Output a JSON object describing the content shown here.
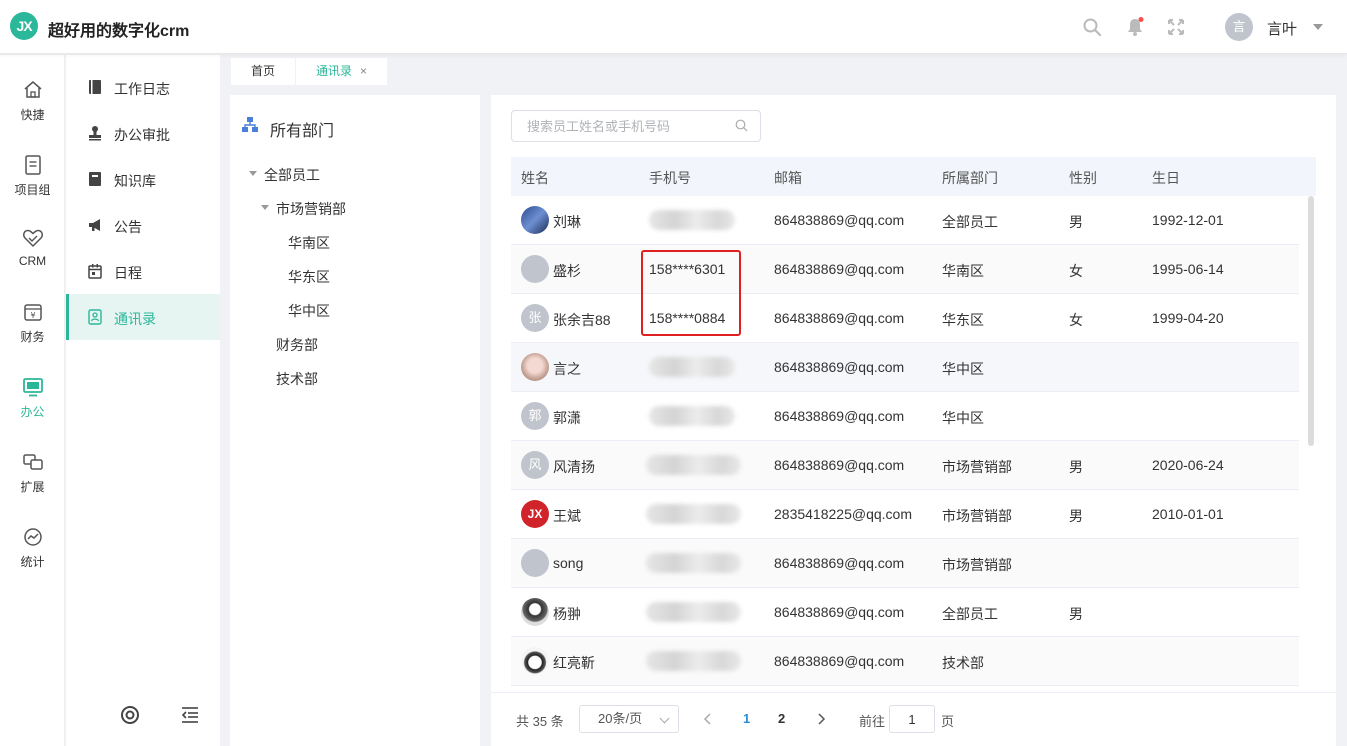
{
  "app": {
    "logo_text": "JX",
    "title": "超好用的数字化crm"
  },
  "header": {
    "user": {
      "avatar_text": "言",
      "name": "言叶"
    },
    "colors": {
      "accent": "#2bb89a",
      "notification_dot": "#ff4d4f"
    }
  },
  "nav_primary": [
    {
      "label": "快捷",
      "icon": "home-icon"
    },
    {
      "label": "项目组",
      "icon": "document-icon"
    },
    {
      "label": "CRM",
      "icon": "handshake-icon"
    },
    {
      "label": "财务",
      "icon": "wallet-icon"
    },
    {
      "label": "办公",
      "icon": "monitor-icon",
      "active": true
    },
    {
      "label": "扩展",
      "icon": "extend-icon"
    },
    {
      "label": "统计",
      "icon": "chart-icon"
    }
  ],
  "nav_secondary": [
    {
      "label": "工作日志",
      "icon": "book-icon"
    },
    {
      "label": "办公审批",
      "icon": "stamp-icon"
    },
    {
      "label": "知识库",
      "icon": "notebook-icon"
    },
    {
      "label": "公告",
      "icon": "megaphone-icon"
    },
    {
      "label": "日程",
      "icon": "calendar-icon"
    },
    {
      "label": "通讯录",
      "icon": "contacts-icon",
      "active": true
    }
  ],
  "tabs": [
    {
      "label": "首页"
    },
    {
      "label": "通讯录",
      "active": true,
      "close": "×"
    }
  ],
  "departments": {
    "title": "所有部门",
    "tree": [
      {
        "label": "全部员工"
      },
      {
        "label": "市场营销部"
      },
      {
        "label": "华南区"
      },
      {
        "label": "华东区"
      },
      {
        "label": "华中区"
      },
      {
        "label": "财务部"
      },
      {
        "label": "技术部"
      }
    ]
  },
  "search": {
    "placeholder": "搜索员工姓名或手机号码",
    "value": ""
  },
  "table": {
    "columns": [
      "姓名",
      "手机号",
      "邮箱",
      "所属部门",
      "性别",
      "生日"
    ],
    "rows": [
      {
        "name": "刘琳",
        "avatar": "",
        "phone": "",
        "email": "864838869@qq.com",
        "dept": "全部员工",
        "gender": "男",
        "birthday": "1992-12-01"
      },
      {
        "name": "盛杉",
        "avatar": "",
        "phone": "158****6301",
        "email": "864838869@qq.com",
        "dept": "华南区",
        "gender": "女",
        "birthday": "1995-06-14"
      },
      {
        "name": "张余吉88",
        "avatar": "张",
        "phone": "158****0884",
        "email": "864838869@qq.com",
        "dept": "华东区",
        "gender": "女",
        "birthday": "1999-04-20"
      },
      {
        "name": "言之",
        "avatar": "",
        "phone": "",
        "email": "864838869@qq.com",
        "dept": "华中区",
        "gender": "",
        "birthday": ""
      },
      {
        "name": "郭潇",
        "avatar": "郭",
        "phone": "",
        "email": "864838869@qq.com",
        "dept": "华中区",
        "gender": "",
        "birthday": ""
      },
      {
        "name": "风清扬",
        "avatar": "风",
        "phone": "",
        "email": "864838869@qq.com",
        "dept": "市场营销部",
        "gender": "男",
        "birthday": "2020-06-24"
      },
      {
        "name": "王斌",
        "avatar": "JX",
        "phone": "",
        "email": "2835418225@qq.com",
        "dept": "市场营销部",
        "gender": "男",
        "birthday": "2010-01-01"
      },
      {
        "name": "song",
        "avatar": "",
        "phone": "",
        "email": "864838869@qq.com",
        "dept": "市场营销部",
        "gender": "",
        "birthday": ""
      },
      {
        "name": "杨翀",
        "avatar": "",
        "phone": "",
        "email": "864838869@qq.com",
        "dept": "全部员工",
        "gender": "男",
        "birthday": ""
      },
      {
        "name": "红亮靳",
        "avatar": "",
        "phone": "",
        "email": "864838869@qq.com",
        "dept": "技术部",
        "gender": "",
        "birthday": ""
      }
    ]
  },
  "pagination": {
    "total": "共 35 条",
    "page_size": "20条/页",
    "pages": [
      "1",
      "2"
    ],
    "current": "1",
    "goto_label": "前往",
    "goto_value": "1",
    "page_suffix": "页"
  }
}
